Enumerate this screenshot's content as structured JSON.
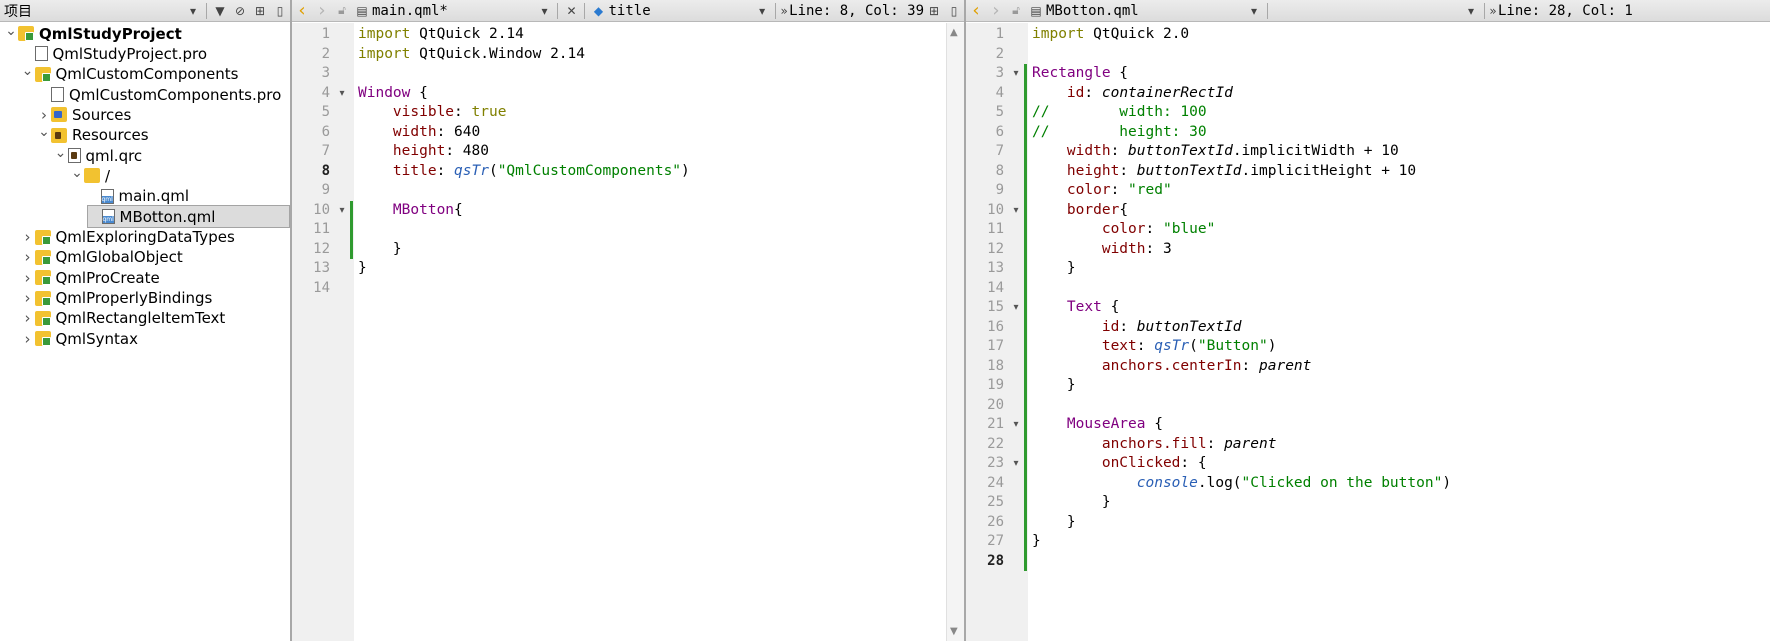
{
  "project_panel": {
    "title": "项目",
    "tree": [
      {
        "label": "QmlStudyProject",
        "icon": "folder",
        "depth": 0,
        "expand": "open",
        "bold": true
      },
      {
        "label": "QmlStudyProject.pro",
        "icon": "file",
        "depth": 1,
        "expand": "none"
      },
      {
        "label": "QmlCustomComponents",
        "icon": "folder",
        "depth": 1,
        "expand": "open"
      },
      {
        "label": "QmlCustomComponents.pro",
        "icon": "file",
        "depth": 2,
        "expand": "none"
      },
      {
        "label": "Sources",
        "icon": "sources",
        "depth": 2,
        "expand": "closed"
      },
      {
        "label": "Resources",
        "icon": "lockfolder",
        "depth": 2,
        "expand": "open"
      },
      {
        "label": "qml.qrc",
        "icon": "qrc",
        "depth": 3,
        "expand": "open"
      },
      {
        "label": "/",
        "icon": "plainfolder",
        "depth": 4,
        "expand": "open"
      },
      {
        "label": "main.qml",
        "icon": "qml",
        "depth": 5,
        "expand": "none"
      },
      {
        "label": "MBotton.qml",
        "icon": "qml",
        "depth": 5,
        "expand": "none",
        "selected": true
      },
      {
        "label": "QmlExploringDataTypes",
        "icon": "folder",
        "depth": 1,
        "expand": "closed"
      },
      {
        "label": "QmlGlobalObject",
        "icon": "folder",
        "depth": 1,
        "expand": "closed"
      },
      {
        "label": "QmlProCreate",
        "icon": "folder",
        "depth": 1,
        "expand": "closed"
      },
      {
        "label": "QmlProperlyBindings",
        "icon": "folder",
        "depth": 1,
        "expand": "closed"
      },
      {
        "label": "QmlRectangleItemText",
        "icon": "folder",
        "depth": 1,
        "expand": "closed"
      },
      {
        "label": "QmlSyntax",
        "icon": "folder",
        "depth": 1,
        "expand": "closed"
      }
    ]
  },
  "editor_left": {
    "file_name": "main.qml*",
    "symbol": "title",
    "cursor_pos": "Line: 8, Col: 39",
    "current_line": 8,
    "folds": [
      4,
      10
    ],
    "modified_lines": [
      10,
      11,
      12
    ],
    "lines": [
      [
        [
          "kw",
          "import"
        ],
        [
          "",
          "QtQuick 2.14"
        ]
      ],
      [
        [
          "kw",
          "import"
        ],
        [
          "",
          "QtQuick.Window 2.14"
        ]
      ],
      [],
      [
        [
          "ty",
          "Window"
        ],
        [
          "",
          " {"
        ]
      ],
      [
        [
          "",
          "    "
        ],
        [
          "pr",
          "visible"
        ],
        [
          "",
          ": "
        ],
        [
          "kw",
          "true"
        ]
      ],
      [
        [
          "",
          "    "
        ],
        [
          "pr",
          "width"
        ],
        [
          "",
          ": 640"
        ]
      ],
      [
        [
          "",
          "    "
        ],
        [
          "pr",
          "height"
        ],
        [
          "",
          ": 480"
        ]
      ],
      [
        [
          "",
          "    "
        ],
        [
          "pr",
          "title"
        ],
        [
          "",
          ": "
        ],
        [
          "fn",
          "qsTr"
        ],
        [
          "",
          "("
        ],
        [
          "st",
          "\"QmlCustomComponents\""
        ],
        [
          "",
          ")"
        ]
      ],
      [],
      [
        [
          "",
          "    "
        ],
        [
          "ty",
          "MBotton"
        ],
        [
          "",
          "{"
        ]
      ],
      [],
      [
        [
          "",
          "    }"
        ]
      ],
      [
        [
          "",
          "}"
        ]
      ],
      []
    ]
  },
  "editor_right": {
    "file_name": "MBotton.qml",
    "cursor_pos": "Line: 28, Col: 1",
    "current_line": 28,
    "folds": [
      3,
      10,
      15,
      21,
      23
    ],
    "modified_lines": [
      3,
      4,
      5,
      6,
      7,
      8,
      9,
      10,
      11,
      12,
      13,
      14,
      15,
      16,
      17,
      18,
      19,
      20,
      21,
      22,
      23,
      24,
      25,
      26,
      27,
      28
    ],
    "lines": [
      [
        [
          "kw",
          "import"
        ],
        [
          "",
          "QtQuick 2.0"
        ]
      ],
      [],
      [
        [
          "ty",
          "Rectangle"
        ],
        [
          "",
          " {"
        ]
      ],
      [
        [
          "",
          "    "
        ],
        [
          "pr",
          "id"
        ],
        [
          "",
          ": "
        ],
        [
          "it",
          "containerRectId"
        ]
      ],
      [
        [
          "cm",
          "//        width: 100"
        ]
      ],
      [
        [
          "cm",
          "//        height: 30"
        ]
      ],
      [
        [
          "",
          "    "
        ],
        [
          "pr",
          "width"
        ],
        [
          "",
          ": "
        ],
        [
          "it",
          "buttonTextId"
        ],
        [
          "",
          ".implicitWidth + 10"
        ]
      ],
      [
        [
          "",
          "    "
        ],
        [
          "pr",
          "height"
        ],
        [
          "",
          ": "
        ],
        [
          "it",
          "buttonTextId"
        ],
        [
          "",
          ".implicitHeight + 10"
        ]
      ],
      [
        [
          "",
          "    "
        ],
        [
          "pr",
          "color"
        ],
        [
          "",
          ": "
        ],
        [
          "st",
          "\"red\""
        ]
      ],
      [
        [
          "",
          "    "
        ],
        [
          "pr",
          "border"
        ],
        [
          "",
          "{"
        ]
      ],
      [
        [
          "",
          "        "
        ],
        [
          "pr",
          "color"
        ],
        [
          "",
          ": "
        ],
        [
          "st",
          "\"blue\""
        ]
      ],
      [
        [
          "",
          "        "
        ],
        [
          "pr",
          "width"
        ],
        [
          "",
          ": 3"
        ]
      ],
      [
        [
          "",
          "    }"
        ]
      ],
      [],
      [
        [
          "",
          "    "
        ],
        [
          "ty",
          "Text"
        ],
        [
          "",
          " {"
        ]
      ],
      [
        [
          "",
          "        "
        ],
        [
          "pr",
          "id"
        ],
        [
          "",
          ": "
        ],
        [
          "it",
          "buttonTextId"
        ]
      ],
      [
        [
          "",
          "        "
        ],
        [
          "pr",
          "text"
        ],
        [
          "",
          ": "
        ],
        [
          "fn",
          "qsTr"
        ],
        [
          "",
          "("
        ],
        [
          "st",
          "\"Button\""
        ],
        [
          "",
          ")"
        ]
      ],
      [
        [
          "",
          "        "
        ],
        [
          "pr",
          "anchors.centerIn"
        ],
        [
          "",
          ": "
        ],
        [
          "it",
          "parent"
        ]
      ],
      [
        [
          "",
          "    }"
        ]
      ],
      [],
      [
        [
          "",
          "    "
        ],
        [
          "ty",
          "MouseArea"
        ],
        [
          "",
          " {"
        ]
      ],
      [
        [
          "",
          "        "
        ],
        [
          "pr",
          "anchors.fill"
        ],
        [
          "",
          ": "
        ],
        [
          "it",
          "parent"
        ]
      ],
      [
        [
          "",
          "        "
        ],
        [
          "pr",
          "onClicked"
        ],
        [
          "",
          ": {"
        ]
      ],
      [
        [
          "",
          "            "
        ],
        [
          "fn",
          "console"
        ],
        [
          "",
          ".log("
        ],
        [
          "st",
          "\"Clicked on the button\""
        ],
        [
          "",
          ")"
        ]
      ],
      [
        [
          "",
          "        }"
        ]
      ],
      [
        [
          "",
          "    }"
        ]
      ],
      [
        [
          "",
          "}"
        ]
      ],
      []
    ]
  }
}
